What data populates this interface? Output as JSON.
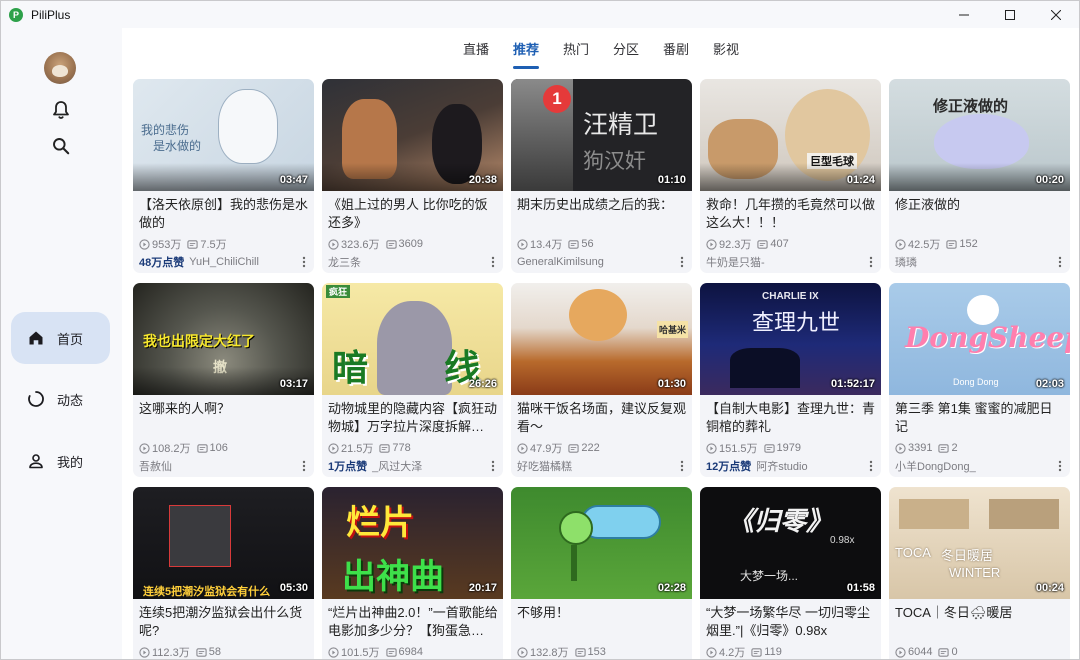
{
  "app": {
    "title": "PiliPlus",
    "icon_letter": "P"
  },
  "window_controls": {
    "minimize": "minimize",
    "maximize": "maximize",
    "close": "close"
  },
  "sidebar": {
    "top_icons": [
      "bell-icon",
      "search-icon"
    ],
    "items": [
      {
        "label": "首页",
        "icon": "home-icon",
        "active": true
      },
      {
        "label": "动态",
        "icon": "dynamic-icon",
        "active": false
      },
      {
        "label": "我的",
        "icon": "person-icon",
        "active": false
      }
    ]
  },
  "tabs": [
    {
      "label": "直播",
      "active": false
    },
    {
      "label": "推荐",
      "active": true
    },
    {
      "label": "热门",
      "active": false
    },
    {
      "label": "分区",
      "active": false
    },
    {
      "label": "番剧",
      "active": false
    },
    {
      "label": "影视",
      "active": false
    }
  ],
  "colors": {
    "accent": "#1e5fb3",
    "nav_active_bg": "#d8e3f4"
  },
  "videos": [
    {
      "title": "【洛天依原创】我的悲伤是水做的",
      "duration": "03:47",
      "views": "953万",
      "danmaku": "7.5万",
      "badge": "48万点赞",
      "author": "YuH_ChiliChill",
      "thumb_text": [
        "我的悲伤",
        "是水做的"
      ]
    },
    {
      "title": "《姐上过的男人 比你吃的饭还多》",
      "duration": "20:38",
      "views": "323.6万",
      "danmaku": "3609",
      "badge": "",
      "author": "龙三条",
      "thumb_text": []
    },
    {
      "title": "期末历史出成绩之后的我：",
      "duration": "01:10",
      "views": "13.4万",
      "danmaku": "56",
      "badge": "",
      "author": "GeneralKimilsung",
      "thumb_text": [
        "汪精卫",
        "狗汉奸",
        "1"
      ]
    },
    {
      "title": "救命！几年攒的毛竟然可以做这么大！！！",
      "duration": "01:24",
      "views": "92.3万",
      "danmaku": "407",
      "badge": "",
      "author": "牛奶是只猫-",
      "thumb_text": [
        "巨型毛球"
      ]
    },
    {
      "title": "修正液做的",
      "duration": "00:20",
      "views": "42.5万",
      "danmaku": "152",
      "badge": "",
      "author": "璘璘",
      "thumb_text": [
        "修正液做的"
      ]
    },
    {
      "title": "这哪来的人啊？",
      "duration": "03:17",
      "views": "108.2万",
      "danmaku": "106",
      "badge": "",
      "author": "吾赦仙",
      "thumb_text": [
        "我也出限定大红了",
        "撤"
      ]
    },
    {
      "title": "动物城里的隐藏内容【疯狂动物城】万字拉片深度拆解…",
      "duration": "26:26",
      "views": "21.5万",
      "danmaku": "778",
      "badge": "1万点赞",
      "author": "_风过大泽",
      "thumb_text": [
        "暗",
        "线",
        "疯狂"
      ]
    },
    {
      "title": "猫咪干饭名场面，建议反复观看～",
      "duration": "01:30",
      "views": "47.9万",
      "danmaku": "222",
      "badge": "",
      "author": "好吃猫橘糕",
      "thumb_text": [
        "哈基米"
      ]
    },
    {
      "title": "【自制大电影】查理九世：青铜棺的葬礼",
      "duration": "01:52:17",
      "views": "151.5万",
      "danmaku": "1979",
      "badge": "12万点赞",
      "author": "阿齐studio",
      "thumb_text": [
        "CHARLIE IX",
        "查理九世"
      ]
    },
    {
      "title": "第三季 第1集 蜜蜜的减肥日记",
      "duration": "02:03",
      "views": "3391",
      "danmaku": "2",
      "badge": "",
      "author": "小羊DongDong_",
      "thumb_text": [
        "DongSheep",
        "Dong Dong"
      ]
    },
    {
      "title": "连续5把潮汐监狱会出什么货呢?",
      "duration": "05:30",
      "views": "112.3万",
      "danmaku": "58",
      "badge": "",
      "author": "",
      "thumb_text": [
        "连续5把潮汐监狱会有什么"
      ]
    },
    {
      "title": "“烂片出神曲2.0！”一首歌能给电影加多少分？【狗蛋急…",
      "duration": "20:17",
      "views": "101.5万",
      "danmaku": "6984",
      "badge": "",
      "author": "",
      "thumb_text": [
        "烂片",
        "出神曲"
      ]
    },
    {
      "title": "不够用！",
      "duration": "02:28",
      "views": "132.8万",
      "danmaku": "153",
      "badge": "",
      "author": "",
      "thumb_text": []
    },
    {
      "title": "“大梦一场繁华尽 一切归零尘烟里.”|《归零》0.98x",
      "duration": "01:58",
      "views": "4.2万",
      "danmaku": "119",
      "badge": "",
      "author": "",
      "thumb_text": [
        "《归零》",
        "0.98x",
        "大梦一场..."
      ]
    },
    {
      "title": "TOCA｜冬日🌨暖居",
      "duration": "00:24",
      "views": "6044",
      "danmaku": "0",
      "badge": "",
      "author": "",
      "thumb_text": [
        "TOCA",
        "冬日暖居",
        "WINTER"
      ]
    }
  ]
}
